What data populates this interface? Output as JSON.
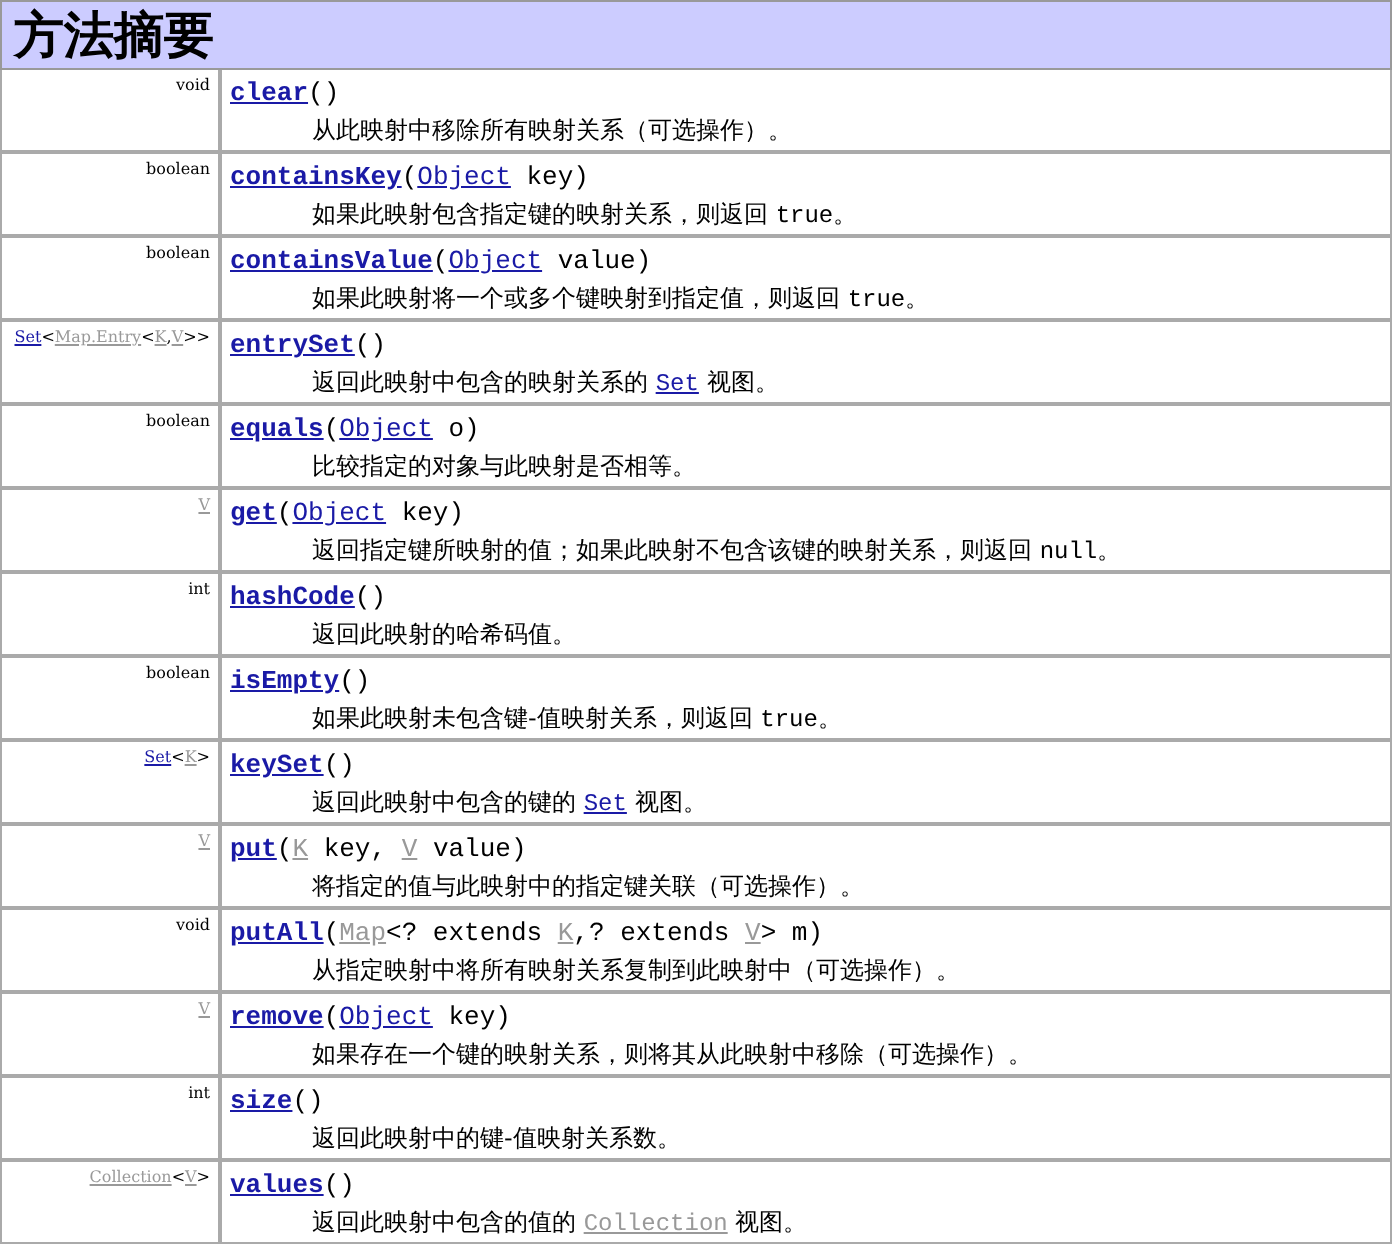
{
  "title": "方法摘要",
  "rows": [
    {
      "type": [
        {
          "kind": "plain",
          "text": "void"
        }
      ],
      "signature": [
        {
          "kind": "method",
          "text": "clear"
        },
        {
          "kind": "plain",
          "text": "()"
        }
      ],
      "description": [
        {
          "kind": "plain",
          "text": "从此映射中移除所有映射关系（可选操作）。"
        }
      ]
    },
    {
      "type": [
        {
          "kind": "plain",
          "text": "boolean"
        }
      ],
      "signature": [
        {
          "kind": "method",
          "text": "containsKey"
        },
        {
          "kind": "plain",
          "text": "("
        },
        {
          "kind": "link",
          "text": "Object"
        },
        {
          "kind": "plain",
          "text": " key)"
        }
      ],
      "description": [
        {
          "kind": "plain",
          "text": "如果此映射包含指定键的映射关系，则返回 "
        },
        {
          "kind": "code",
          "text": "true"
        },
        {
          "kind": "plain",
          "text": "。"
        }
      ]
    },
    {
      "type": [
        {
          "kind": "plain",
          "text": "boolean"
        }
      ],
      "signature": [
        {
          "kind": "method",
          "text": "containsValue"
        },
        {
          "kind": "plain",
          "text": "("
        },
        {
          "kind": "link",
          "text": "Object"
        },
        {
          "kind": "plain",
          "text": " value)"
        }
      ],
      "description": [
        {
          "kind": "plain",
          "text": "如果此映射将一个或多个键映射到指定值，则返回 "
        },
        {
          "kind": "code",
          "text": "true"
        },
        {
          "kind": "plain",
          "text": "。"
        }
      ]
    },
    {
      "type": [
        {
          "kind": "link",
          "text": "Set"
        },
        {
          "kind": "plain",
          "text": "<"
        },
        {
          "kind": "param",
          "text": "Map.Entry"
        },
        {
          "kind": "plain",
          "text": "<"
        },
        {
          "kind": "param",
          "text": "K"
        },
        {
          "kind": "plain",
          "text": ","
        },
        {
          "kind": "param",
          "text": "V"
        },
        {
          "kind": "plain",
          "text": ">>"
        }
      ],
      "signature": [
        {
          "kind": "method",
          "text": "entrySet"
        },
        {
          "kind": "plain",
          "text": "()"
        }
      ],
      "description": [
        {
          "kind": "plain",
          "text": "返回此映射中包含的映射关系的 "
        },
        {
          "kind": "link",
          "text": "Set"
        },
        {
          "kind": "plain",
          "text": " 视图。"
        }
      ]
    },
    {
      "type": [
        {
          "kind": "plain",
          "text": "boolean"
        }
      ],
      "signature": [
        {
          "kind": "method",
          "text": "equals"
        },
        {
          "kind": "plain",
          "text": "("
        },
        {
          "kind": "link",
          "text": "Object"
        },
        {
          "kind": "plain",
          "text": " o)"
        }
      ],
      "description": [
        {
          "kind": "plain",
          "text": "比较指定的对象与此映射是否相等。"
        }
      ]
    },
    {
      "type": [
        {
          "kind": "param",
          "text": "V"
        }
      ],
      "signature": [
        {
          "kind": "method",
          "text": "get"
        },
        {
          "kind": "plain",
          "text": "("
        },
        {
          "kind": "link",
          "text": "Object"
        },
        {
          "kind": "plain",
          "text": " key)"
        }
      ],
      "description": [
        {
          "kind": "plain",
          "text": "返回指定键所映射的值；如果此映射不包含该键的映射关系，则返回 "
        },
        {
          "kind": "code",
          "text": "null"
        },
        {
          "kind": "plain",
          "text": "。"
        }
      ]
    },
    {
      "type": [
        {
          "kind": "plain",
          "text": "int"
        }
      ],
      "signature": [
        {
          "kind": "method",
          "text": "hashCode"
        },
        {
          "kind": "plain",
          "text": "()"
        }
      ],
      "description": [
        {
          "kind": "plain",
          "text": "返回此映射的哈希码值。"
        }
      ]
    },
    {
      "type": [
        {
          "kind": "plain",
          "text": "boolean"
        }
      ],
      "signature": [
        {
          "kind": "method",
          "text": "isEmpty"
        },
        {
          "kind": "plain",
          "text": "()"
        }
      ],
      "description": [
        {
          "kind": "plain",
          "text": "如果此映射未包含键-值映射关系，则返回 "
        },
        {
          "kind": "code",
          "text": "true"
        },
        {
          "kind": "plain",
          "text": "。"
        }
      ]
    },
    {
      "type": [
        {
          "kind": "link",
          "text": "Set"
        },
        {
          "kind": "plain",
          "text": "<"
        },
        {
          "kind": "param",
          "text": "K"
        },
        {
          "kind": "plain",
          "text": ">"
        }
      ],
      "signature": [
        {
          "kind": "method",
          "text": "keySet"
        },
        {
          "kind": "plain",
          "text": "()"
        }
      ],
      "description": [
        {
          "kind": "plain",
          "text": "返回此映射中包含的键的 "
        },
        {
          "kind": "link",
          "text": "Set"
        },
        {
          "kind": "plain",
          "text": " 视图。"
        }
      ]
    },
    {
      "type": [
        {
          "kind": "param",
          "text": "V"
        }
      ],
      "signature": [
        {
          "kind": "method",
          "text": "put"
        },
        {
          "kind": "plain",
          "text": "("
        },
        {
          "kind": "param",
          "text": "K"
        },
        {
          "kind": "plain",
          "text": " key, "
        },
        {
          "kind": "param",
          "text": "V"
        },
        {
          "kind": "plain",
          "text": " value)"
        }
      ],
      "description": [
        {
          "kind": "plain",
          "text": "将指定的值与此映射中的指定键关联（可选操作）。"
        }
      ]
    },
    {
      "type": [
        {
          "kind": "plain",
          "text": "void"
        }
      ],
      "signature": [
        {
          "kind": "method",
          "text": "putAll"
        },
        {
          "kind": "plain",
          "text": "("
        },
        {
          "kind": "param",
          "text": "Map"
        },
        {
          "kind": "plain",
          "text": "<? extends "
        },
        {
          "kind": "param",
          "text": "K"
        },
        {
          "kind": "plain",
          "text": ",? extends "
        },
        {
          "kind": "param",
          "text": "V"
        },
        {
          "kind": "plain",
          "text": "> m)"
        }
      ],
      "description": [
        {
          "kind": "plain",
          "text": "从指定映射中将所有映射关系复制到此映射中（可选操作）。"
        }
      ]
    },
    {
      "type": [
        {
          "kind": "param",
          "text": "V"
        }
      ],
      "signature": [
        {
          "kind": "method",
          "text": "remove"
        },
        {
          "kind": "plain",
          "text": "("
        },
        {
          "kind": "link",
          "text": "Object"
        },
        {
          "kind": "plain",
          "text": " key)"
        }
      ],
      "description": [
        {
          "kind": "plain",
          "text": "如果存在一个键的映射关系，则将其从此映射中移除（可选操作）。"
        }
      ]
    },
    {
      "type": [
        {
          "kind": "plain",
          "text": "int"
        }
      ],
      "signature": [
        {
          "kind": "method",
          "text": "size"
        },
        {
          "kind": "plain",
          "text": "()"
        }
      ],
      "description": [
        {
          "kind": "plain",
          "text": "返回此映射中的键-值映射关系数。"
        }
      ]
    },
    {
      "type": [
        {
          "kind": "param",
          "text": "Collection"
        },
        {
          "kind": "plain",
          "text": "<"
        },
        {
          "kind": "param",
          "text": "V"
        },
        {
          "kind": "plain",
          "text": ">"
        }
      ],
      "signature": [
        {
          "kind": "method",
          "text": "values"
        },
        {
          "kind": "plain",
          "text": "()"
        }
      ],
      "description": [
        {
          "kind": "plain",
          "text": "返回此映射中包含的值的 "
        },
        {
          "kind": "param",
          "text": "Collection"
        },
        {
          "kind": "plain",
          "text": " 视图。"
        }
      ]
    }
  ]
}
